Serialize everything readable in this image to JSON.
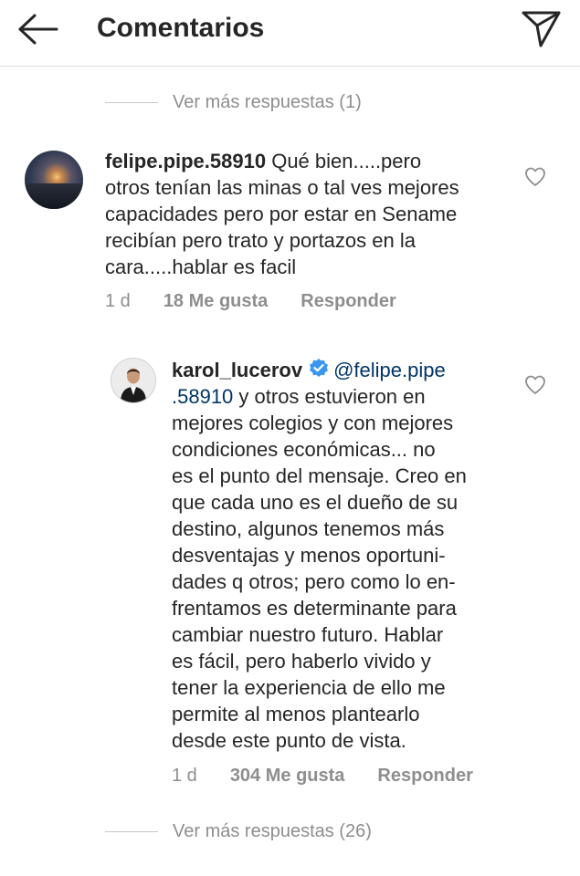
{
  "header": {
    "title": "Comentarios"
  },
  "threads": {
    "more_replies_top": "Ver más respuestas (1)",
    "more_replies_bottom": "Ver más respuestas (26)"
  },
  "comments": [
    {
      "username": "felipe.pipe.58910",
      "lines": [
        " Qué bien.....pero",
        "otros tenían las minas o tal ves mejores",
        "capacidades pero por estar en Sename",
        "recibían pero trato y portazos en la",
        "cara.....hablar es facil"
      ],
      "time": "1 d",
      "likes": "18 Me gusta",
      "reply": "Responder"
    },
    {
      "username": "karol_lucerov",
      "mention_part1": "@felipe.pipe",
      "mention_part2": ".58910",
      "first_line_rest": " y otros estuvieron en",
      "lines": [
        "mejores colegios y con mejores",
        "condiciones económicas... no",
        "es el punto del mensaje. Creo en",
        "que cada uno es el dueño de su",
        "destino, algunos tenemos más",
        "desventajas y menos oportuni-",
        "dades q otros; pero como lo en-",
        "frentamos es determinante para",
        "cambiar nuestro futuro. Hablar",
        "es fácil, pero haberlo vivido y",
        "tener la experiencia de ello me",
        "permite al menos plantearlo",
        "desde este punto de vista."
      ],
      "time": "1 d",
      "likes": "304 Me gusta",
      "reply": "Responder"
    }
  ],
  "colors": {
    "text": "#262626",
    "secondary": "#8e8e8e",
    "mention": "#003569",
    "verified": "#3897f0"
  },
  "icons": [
    "back-arrow-icon",
    "send-icon",
    "heart-icon",
    "verified-badge-icon"
  ]
}
